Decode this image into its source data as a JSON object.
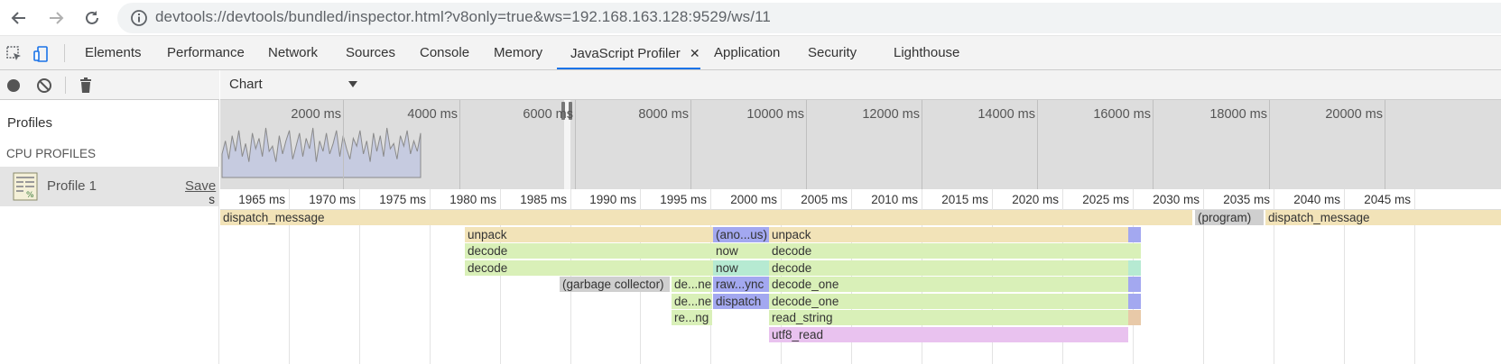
{
  "browser": {
    "url": "devtools://devtools/bundled/inspector.html?v8only=true&ws=192.168.163.128:9529/ws/11"
  },
  "devtools": {
    "tabs": [
      {
        "label": "Elements"
      },
      {
        "label": "Performance"
      },
      {
        "label": "Network"
      },
      {
        "label": "Sources"
      },
      {
        "label": "Console"
      },
      {
        "label": "Memory"
      },
      {
        "label": "JavaScript Profiler"
      },
      {
        "label": "Application"
      },
      {
        "label": "Security"
      },
      {
        "label": "Lighthouse"
      }
    ],
    "active_tab": "JavaScript Profiler",
    "tab_close_glyph": "✕"
  },
  "sidebar": {
    "profiles_title": "Profiles",
    "cpu_profiles_title": "CPU PROFILES",
    "profile_name": "Profile 1",
    "save_label": "Save"
  },
  "main": {
    "view_select": "Chart",
    "overview_labels": [
      "2000 ms",
      "4000 ms",
      "6000 ms",
      "8000 ms",
      "10000 ms",
      "12000 ms",
      "14000 ms",
      "16000 ms",
      "18000 ms",
      "20000 ms"
    ],
    "overview_activity": [
      0.45,
      0.7,
      0.35,
      0.8,
      0.5,
      0.9,
      0.4,
      0.65,
      0.3,
      0.85,
      0.55,
      0.75,
      0.4,
      0.95,
      0.5,
      0.6,
      0.3,
      0.8,
      0.45,
      0.7,
      0.9,
      0.35,
      0.6,
      0.85,
      0.4,
      0.75,
      0.55,
      0.95,
      0.3,
      0.7,
      0.5,
      0.85,
      0.45,
      0.65,
      0.9,
      0.4,
      0.8,
      0.55,
      0.35,
      0.75,
      0.6,
      0.9,
      0.45,
      0.7,
      0.3,
      0.85,
      0.5,
      0.8,
      0.4,
      0.95,
      0.55,
      0.65,
      0.35,
      0.8,
      0.6,
      0.9,
      0.45,
      0.7,
      0.5,
      0.85
    ],
    "flame_labels": [
      "s",
      "1965 ms",
      "1970 ms",
      "1975 ms",
      "1980 ms",
      "1985 ms",
      "1990 ms",
      "1995 ms",
      "2000 ms",
      "2005 ms",
      "2010 ms",
      "2015 ms",
      "2020 ms",
      "2025 ms",
      "2030 ms",
      "2035 ms",
      "2040 ms",
      "2045 ms"
    ],
    "flame_bars": [
      {
        "label": "dispatch_message",
        "color": "#f2e3b8"
      },
      {
        "label": "(program)",
        "color": "#cfcfcf"
      },
      {
        "label": "dispatch_message",
        "color": "#f2e3b8"
      },
      {
        "label": "unpack",
        "color": "#f2e3b8"
      },
      {
        "label": "(ano...us)",
        "color": "#a3a8f0"
      },
      {
        "label": "unpack",
        "color": "#f2e3b8"
      },
      {
        "label": "decode",
        "color": "#d9f0b8"
      },
      {
        "label": "now",
        "color": "#d9f0b8"
      },
      {
        "label": "decode",
        "color": "#d9f0b8"
      },
      {
        "label": "decode",
        "color": "#d9f0b8"
      },
      {
        "label": "now",
        "color": "#b6ead2"
      },
      {
        "label": "decode",
        "color": "#d9f0b8"
      },
      {
        "label": "(garbage collector)",
        "color": "#cfcfcf"
      },
      {
        "label": "de...ne",
        "color": "#d9f0b8"
      },
      {
        "label": "raw...ync",
        "color": "#a3a8f0"
      },
      {
        "label": "decode_one",
        "color": "#d9f0b8"
      },
      {
        "label": "de...ne",
        "color": "#d9f0b8"
      },
      {
        "label": "dispatch",
        "color": "#a3a8f0"
      },
      {
        "label": "decode_one",
        "color": "#d9f0b8"
      },
      {
        "label": "re...ng",
        "color": "#d9f0b8"
      },
      {
        "label": "read_string",
        "color": "#d9f0b8"
      },
      {
        "label": "utf8_read",
        "color": "#e9c2ef"
      },
      {
        "label": "",
        "color": "#a3a8f0"
      },
      {
        "label": "",
        "color": "#d9f0b8"
      },
      {
        "label": "",
        "color": "#b6ead2"
      },
      {
        "label": "",
        "color": "#a3a8f0"
      },
      {
        "label": "",
        "color": "#a3a8f0"
      },
      {
        "label": "",
        "color": "#e8c9a8"
      }
    ]
  }
}
